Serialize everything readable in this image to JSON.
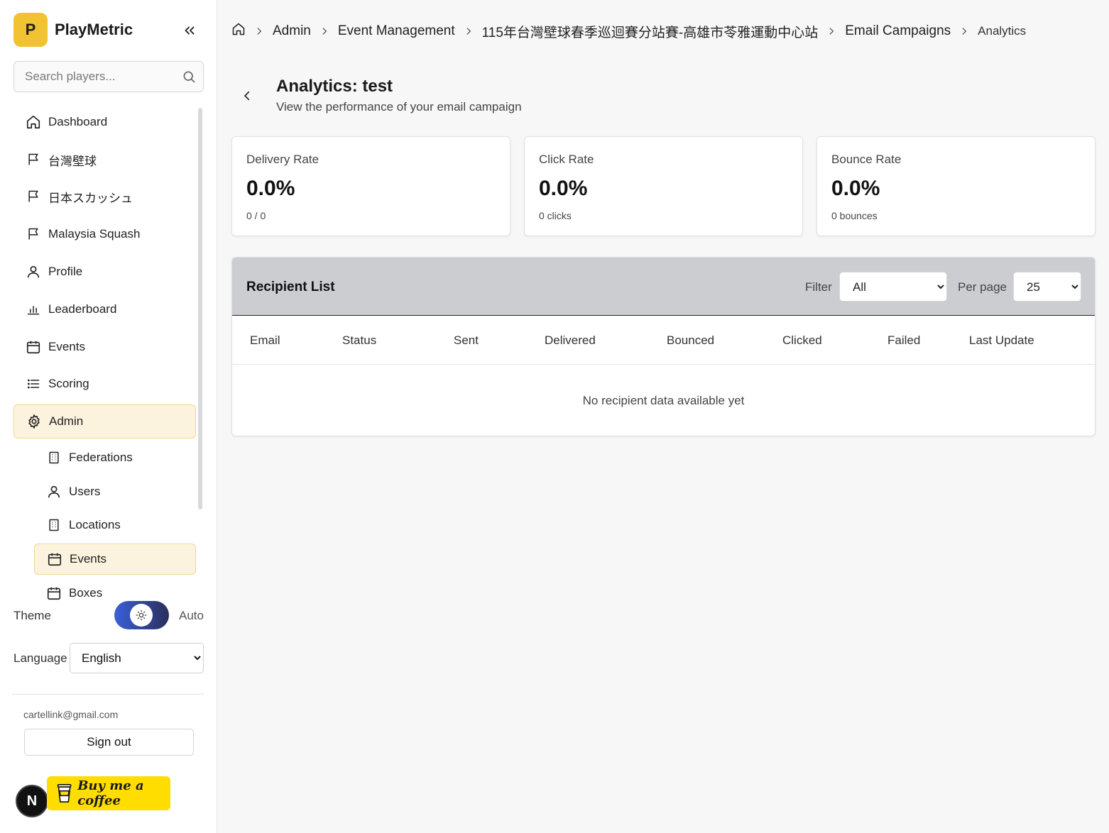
{
  "app": {
    "logo_letter": "P",
    "name": "PlayMetric"
  },
  "search": {
    "placeholder": "Search players..."
  },
  "nav": {
    "items": [
      {
        "label": "Dashboard"
      },
      {
        "label": "台灣壁球"
      },
      {
        "label": "日本スカッシュ"
      },
      {
        "label": "Malaysia Squash"
      },
      {
        "label": "Profile"
      },
      {
        "label": "Leaderboard"
      },
      {
        "label": "Events"
      },
      {
        "label": "Scoring"
      },
      {
        "label": "Admin"
      }
    ],
    "admin_sub": [
      {
        "label": "Federations"
      },
      {
        "label": "Users"
      },
      {
        "label": "Locations"
      },
      {
        "label": "Events"
      },
      {
        "label": "Boxes"
      }
    ]
  },
  "settings": {
    "theme_label": "Theme",
    "theme_value": "Auto",
    "language_label": "Language",
    "language_value": "English"
  },
  "account": {
    "email": "cartellink@gmail.com",
    "signout_label": "Sign out"
  },
  "badges": {
    "next_letter": "N",
    "coffee_label": "Buy me a coffee"
  },
  "breadcrumb": {
    "items": [
      "Admin",
      "Event Management",
      "115年台灣壁球春季巡迴賽分站賽-高雄市苓雅運動中心站",
      "Email Campaigns"
    ],
    "current": "Analytics"
  },
  "page": {
    "title": "Analytics: test",
    "subtitle": "View the performance of your email campaign"
  },
  "stats": [
    {
      "label": "Delivery Rate",
      "value": "0.0%",
      "detail": "0 / 0"
    },
    {
      "label": "Click Rate",
      "value": "0.0%",
      "detail": "0 clicks"
    },
    {
      "label": "Bounce Rate",
      "value": "0.0%",
      "detail": "0 bounces"
    }
  ],
  "recipients": {
    "title": "Recipient List",
    "filter_label": "Filter",
    "filter_value": "All",
    "per_page_label": "Per page",
    "per_page_value": "25",
    "columns": [
      "Email",
      "Status",
      "Sent",
      "Delivered",
      "Bounced",
      "Clicked",
      "Failed",
      "Last Update"
    ],
    "empty_message": "No recipient data available yet"
  },
  "colors": {
    "accent": "#f1c232",
    "active_bg": "#fcf3df",
    "header_bg": "#cbcdd1",
    "coffee": "#ffdd00"
  }
}
